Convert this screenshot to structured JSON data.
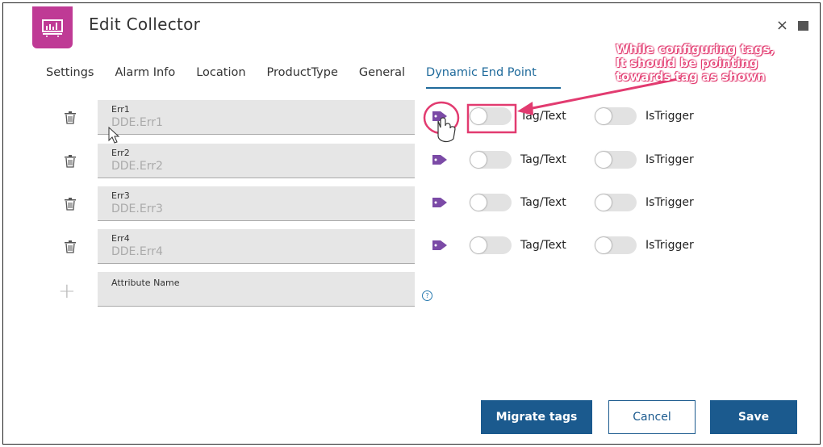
{
  "dialog": {
    "title": "Edit Collector"
  },
  "tabs": [
    {
      "label": "Settings"
    },
    {
      "label": "Alarm Info"
    },
    {
      "label": "Location"
    },
    {
      "label": "ProductType"
    },
    {
      "label": "General"
    },
    {
      "label": "Dynamic End Point"
    }
  ],
  "rows": [
    {
      "name": "Err1",
      "value": "DDE.Err1",
      "toggle1": "Tag/Text",
      "toggle2": "IsTrigger"
    },
    {
      "name": "Err2",
      "value": "DDE.Err2",
      "toggle1": "Tag/Text",
      "toggle2": "IsTrigger"
    },
    {
      "name": "Err3",
      "value": "DDE.Err3",
      "toggle1": "Tag/Text",
      "toggle2": "IsTrigger"
    },
    {
      "name": "Err4",
      "value": "DDE.Err4",
      "toggle1": "Tag/Text",
      "toggle2": "IsTrigger"
    }
  ],
  "new_attribute": {
    "label": "Attribute Name",
    "help": "?"
  },
  "buttons": {
    "migrate": "Migrate tags",
    "cancel": "Cancel",
    "save": "Save"
  },
  "annotation": {
    "line1": "While configuring tags,",
    "line2": "It should be pointing",
    "line3": "towards tag as shown"
  },
  "colors": {
    "brand": "#bf3a95",
    "primary": "#1b5a8e",
    "tag": "#7b4aa6",
    "annotation": "#e23b70"
  }
}
